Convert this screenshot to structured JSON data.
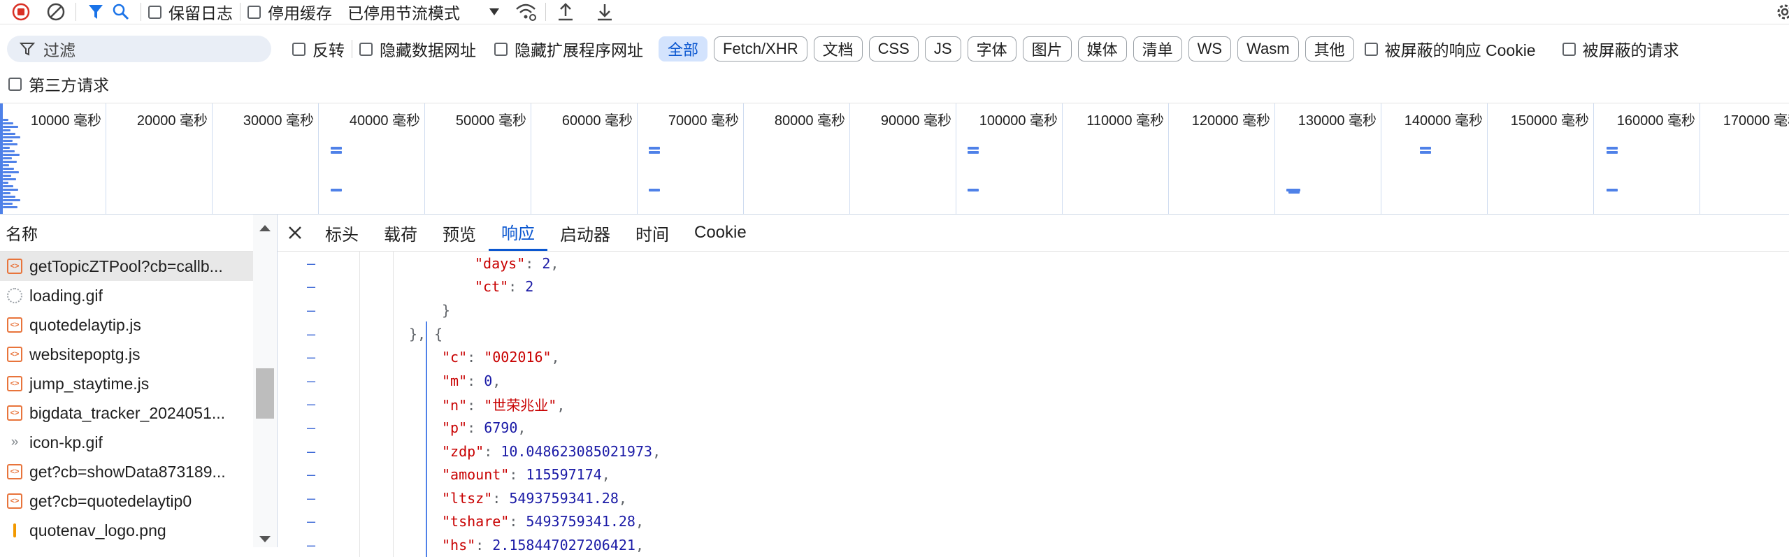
{
  "toolbar": {
    "preserve_log": "保留日志",
    "disable_cache": "停用缓存",
    "throttling": "已停用节流模式"
  },
  "filter": {
    "placeholder": "过滤",
    "invert": "反转",
    "hide_data_urls": "隐藏数据网址",
    "hide_ext_urls": "隐藏扩展程序网址",
    "types": [
      "全部",
      "Fetch/XHR",
      "文档",
      "CSS",
      "JS",
      "字体",
      "图片",
      "媒体",
      "清单",
      "WS",
      "Wasm",
      "其他"
    ],
    "blocked_cookies": "被屏蔽的响应 Cookie",
    "blocked_requests": "被屏蔽的请求",
    "third_party": "第三方请求"
  },
  "overview": {
    "ticks": [
      "10000 毫秒",
      "20000 毫秒",
      "30000 毫秒",
      "40000 毫秒",
      "50000 毫秒",
      "60000 毫秒",
      "70000 毫秒",
      "80000 毫秒",
      "90000 毫秒",
      "100000 毫秒",
      "110000 毫秒",
      "120000 毫秒",
      "130000 毫秒",
      "140000 毫秒",
      "150000 毫秒",
      "160000 毫秒",
      "170000 毫秒"
    ]
  },
  "requests": {
    "header": "名称",
    "items": [
      {
        "name": "getTopicZTPool?cb=callb...",
        "type": "js",
        "selected": true
      },
      {
        "name": "loading.gif",
        "type": "gif"
      },
      {
        "name": "quotedelaytip.js",
        "type": "js"
      },
      {
        "name": "websitepoptg.js",
        "type": "js"
      },
      {
        "name": "jump_staytime.js",
        "type": "js"
      },
      {
        "name": "bigdata_tracker_2024051...",
        "type": "js"
      },
      {
        "name": "icon-kp.gif",
        "type": "chev"
      },
      {
        "name": "get?cb=showData873189...",
        "type": "js"
      },
      {
        "name": "get?cb=quotedelaytip0",
        "type": "js"
      },
      {
        "name": "quotenav_logo.png",
        "type": "png"
      }
    ]
  },
  "detail": {
    "tabs": [
      "标头",
      "载荷",
      "预览",
      "响应",
      "启动器",
      "时间",
      "Cookie"
    ],
    "active_tab": "响应",
    "lines": [
      {
        "indent": 3,
        "key": "\"days\"",
        "value": "2",
        "vtype": "n",
        "trail": ","
      },
      {
        "indent": 3,
        "key": "\"ct\"",
        "value": "2",
        "vtype": "n",
        "trail": ""
      },
      {
        "indent": 2,
        "raw": "}"
      },
      {
        "indent": 1,
        "raw": "}, {"
      },
      {
        "indent": 2,
        "key": "\"c\"",
        "value": "\"002016\"",
        "vtype": "s",
        "trail": ","
      },
      {
        "indent": 2,
        "key": "\"m\"",
        "value": "0",
        "vtype": "n",
        "trail": ","
      },
      {
        "indent": 2,
        "key": "\"n\"",
        "value": "\"世荣兆业\"",
        "vtype": "s",
        "trail": ","
      },
      {
        "indent": 2,
        "key": "\"p\"",
        "value": "6790",
        "vtype": "n",
        "trail": ","
      },
      {
        "indent": 2,
        "key": "\"zdp\"",
        "value": "10.048623085021973",
        "vtype": "n",
        "trail": ","
      },
      {
        "indent": 2,
        "key": "\"amount\"",
        "value": "115597174",
        "vtype": "n",
        "trail": ","
      },
      {
        "indent": 2,
        "key": "\"ltsz\"",
        "value": "5493759341.28",
        "vtype": "n",
        "trail": ","
      },
      {
        "indent": 2,
        "key": "\"tshare\"",
        "value": "5493759341.28",
        "vtype": "n",
        "trail": ","
      },
      {
        "indent": 2,
        "key": "\"hs\"",
        "value": "2.158447027206421",
        "vtype": "n",
        "trail": ","
      }
    ]
  },
  "colors": {
    "accent": "#0b57d0",
    "record": "#d93025",
    "chip_active_bg": "#d3e3fd"
  }
}
